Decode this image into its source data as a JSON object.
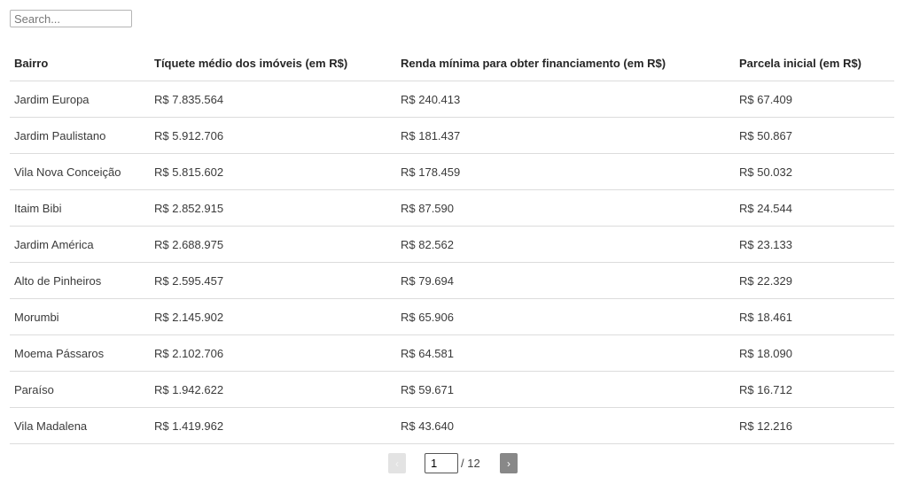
{
  "search": {
    "placeholder": "Search...",
    "value": ""
  },
  "table": {
    "columns": [
      "Bairro",
      "Tíquete médio dos imóveis (em R$)",
      "Renda mínima para obter financiamento (em R$)",
      "Parcela inicial (em R$)"
    ],
    "rows": [
      [
        "Jardim Europa",
        "R$ 7.835.564",
        "R$ 240.413",
        "R$ 67.409"
      ],
      [
        "Jardim Paulistano",
        "R$ 5.912.706",
        "R$ 181.437",
        "R$ 50.867"
      ],
      [
        "Vila Nova Conceição",
        "R$ 5.815.602",
        "R$ 178.459",
        "R$ 50.032"
      ],
      [
        "Itaim Bibi",
        "R$ 2.852.915",
        "R$ 87.590",
        "R$ 24.544"
      ],
      [
        "Jardim América",
        "R$ 2.688.975",
        "R$ 82.562",
        "R$ 23.133"
      ],
      [
        "Alto de Pinheiros",
        "R$ 2.595.457",
        "R$ 79.694",
        "R$ 22.329"
      ],
      [
        "Morumbi",
        "R$ 2.145.902",
        "R$ 65.906",
        "R$ 18.461"
      ],
      [
        "Moema Pássaros",
        "R$ 2.102.706",
        "R$ 64.581",
        "R$ 18.090"
      ],
      [
        "Paraíso",
        "R$ 1.942.622",
        "R$ 59.671",
        "R$ 16.712"
      ],
      [
        "Vila Madalena",
        "R$ 1.419.962",
        "R$ 43.640",
        "R$ 12.216"
      ]
    ]
  },
  "pagination": {
    "prev_icon": "‹",
    "next_icon": "›",
    "current_page": "1",
    "total_label": "/ 12"
  }
}
